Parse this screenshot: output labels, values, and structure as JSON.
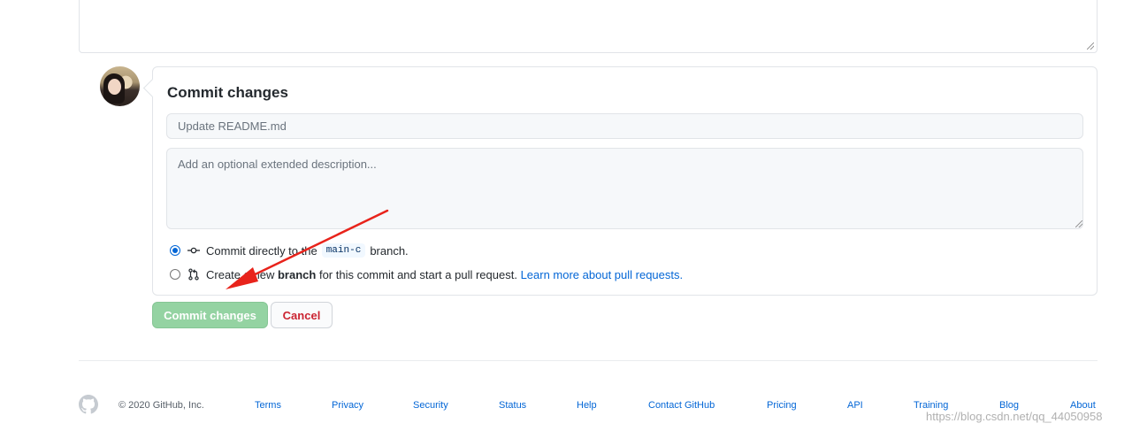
{
  "commit": {
    "title": "Commit changes",
    "summary_placeholder": "Update README.md",
    "description_placeholder": "Add an optional extended description...",
    "option_direct": {
      "prefix": "Commit directly to the",
      "branch": "main-c",
      "suffix": "branch."
    },
    "option_new": {
      "prefix": "Create a",
      "new_text": "new",
      "bold": "branch",
      "middle": "for this commit and start a pull request.",
      "link": "Learn more about pull requests."
    },
    "commit_button": "Commit changes",
    "cancel_button": "Cancel"
  },
  "footer": {
    "copyright": "© 2020 GitHub, Inc.",
    "links": [
      "Terms",
      "Privacy",
      "Security",
      "Status",
      "Help",
      "Contact GitHub",
      "Pricing",
      "API",
      "Training",
      "Blog",
      "About"
    ]
  },
  "watermark": "https://blog.csdn.net/qq_44050958",
  "colors": {
    "accent": "#0366d6",
    "commit_button": "#94d3a2",
    "cancel_text": "#cb2431",
    "annotation_arrow": "#e8231b"
  },
  "icons": {
    "direct_commit": "git-commit-icon",
    "new_branch": "git-pull-request-icon",
    "footer_logo": "github-mark-icon"
  }
}
